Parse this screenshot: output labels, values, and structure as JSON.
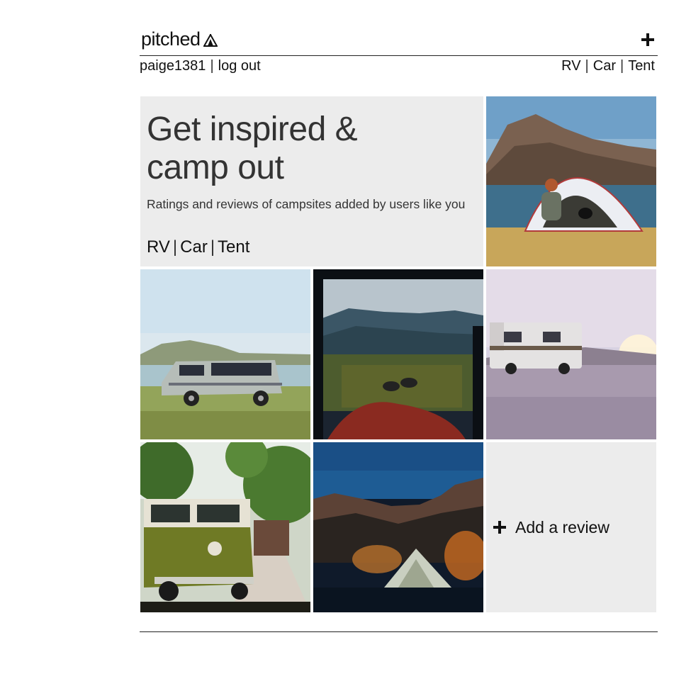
{
  "header": {
    "logo_text": "pitched",
    "logo_icon": "tent-icon",
    "add_icon": "plus-icon"
  },
  "subnav": {
    "username": "paige1381",
    "logout": "log out",
    "categories": [
      "RV",
      "Car",
      "Tent"
    ]
  },
  "hero": {
    "title_line1": "Get inspired &",
    "title_line2": "camp out",
    "subtitle": "Ratings and reviews of campsites added by users like you",
    "categories": [
      "RV",
      "Car",
      "Tent"
    ]
  },
  "tiles": [
    {
      "name": "photo-tent-lake",
      "icon": "photo"
    },
    {
      "name": "photo-van-beach",
      "icon": "photo"
    },
    {
      "name": "photo-car-view",
      "icon": "photo"
    },
    {
      "name": "photo-rv-sunset",
      "icon": "photo"
    },
    {
      "name": "photo-vw-bus",
      "icon": "photo"
    },
    {
      "name": "photo-tent-night",
      "icon": "photo"
    }
  ],
  "add_review": {
    "label": "Add a review",
    "icon": "plus-icon"
  },
  "colors": {
    "panel": "#ececec",
    "text": "#111111",
    "rule": "#222222"
  }
}
